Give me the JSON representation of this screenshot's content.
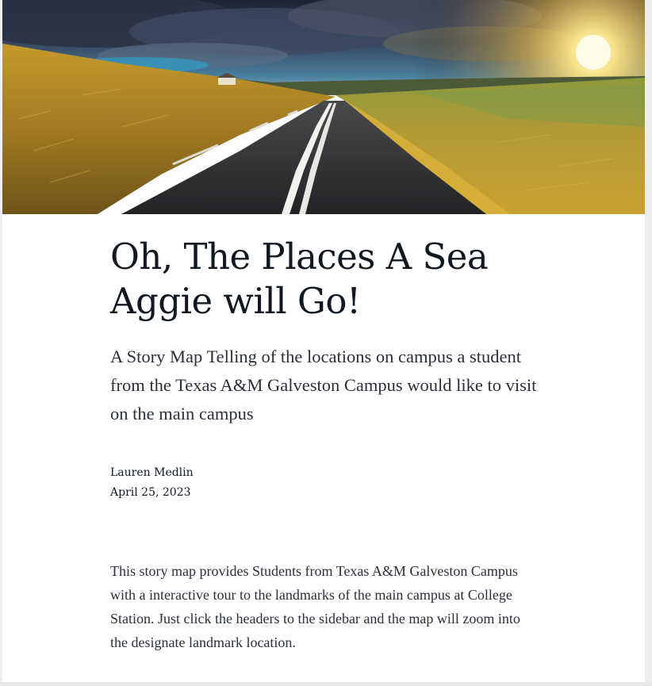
{
  "story": {
    "title": "Oh, The Places A Sea Aggie will Go!",
    "subtitle": "A Story Map Telling of the locations on campus a student from the Texas A&M Galveston Campus would like to visit on the main campus",
    "author": "Lauren Medlin",
    "date": "April 25, 2023",
    "body": "This story map provides Students from Texas A&M Galveston Campus with a interactive tour to the landmarks of the main campus at College Station. Just click the headers to the sidebar and the map will zoom into the designate landmark location."
  },
  "hero_image": {
    "icon": "landscape-road-photo",
    "colors": {
      "sky_dark": "#1e2a44",
      "sky_blue": "#3f8fb5",
      "sun": "#fff3b0",
      "grass": "#b8902a",
      "road": "#2a2a2c"
    }
  }
}
